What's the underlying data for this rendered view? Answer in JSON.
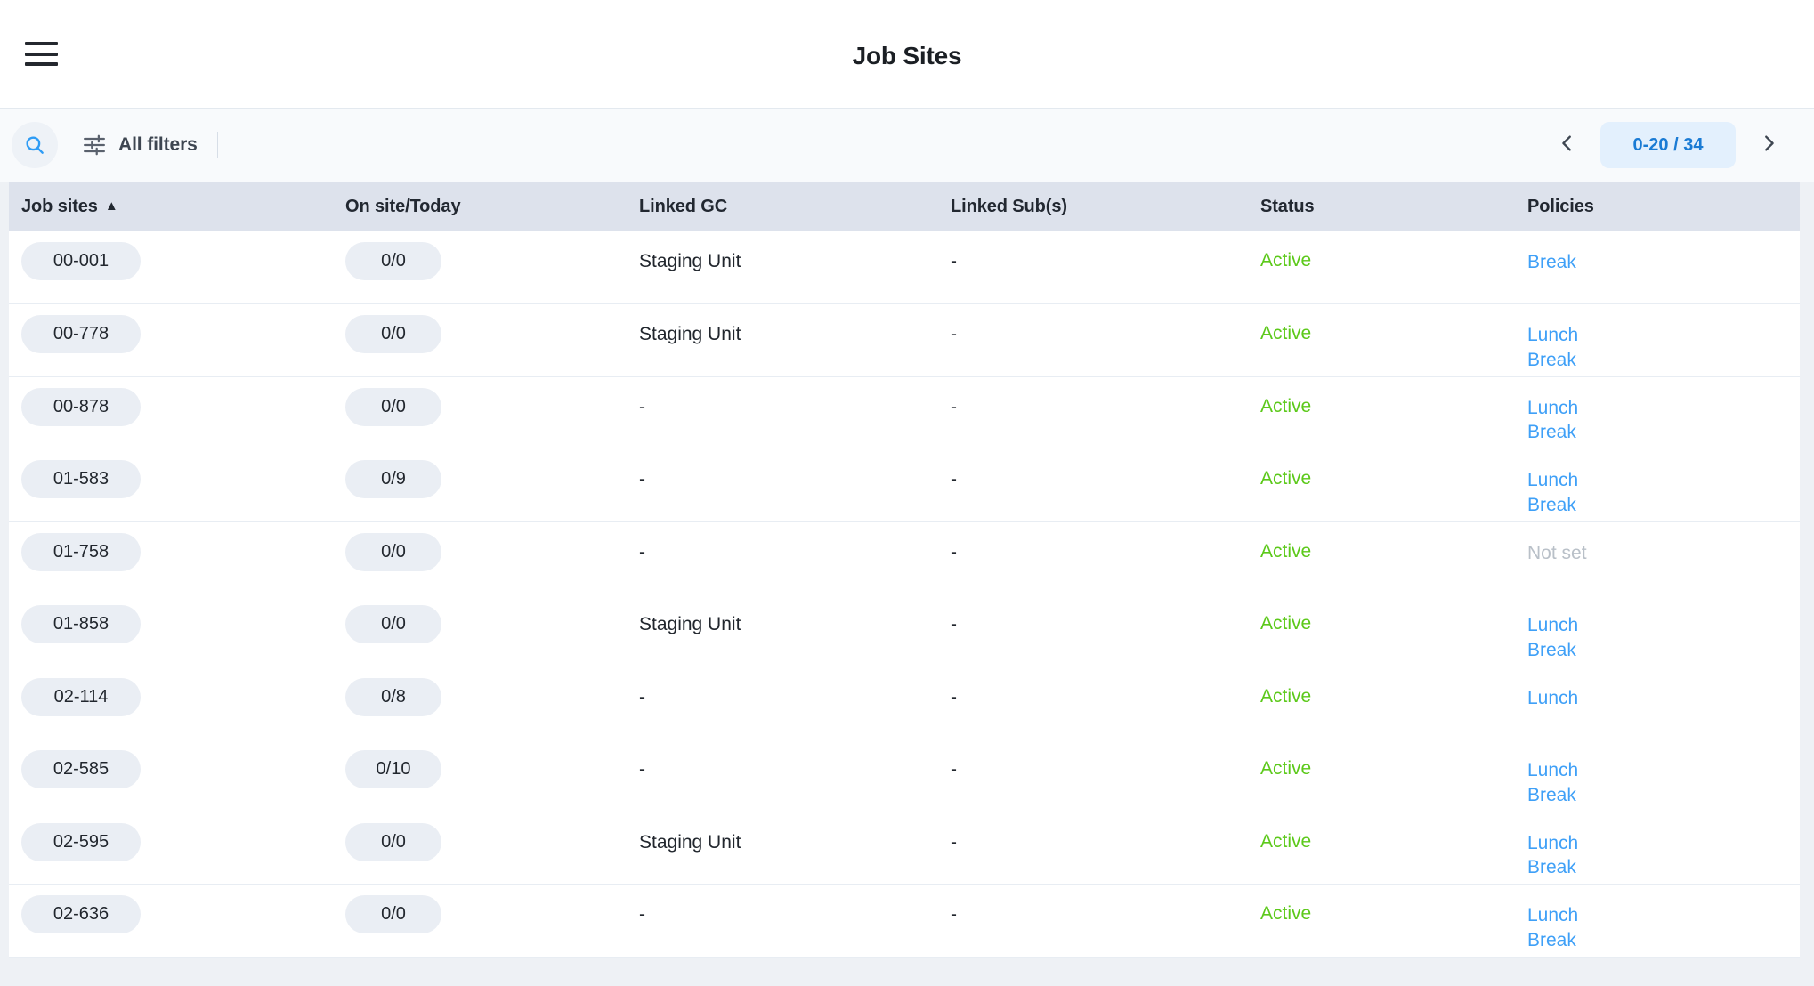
{
  "appbar": {
    "menu_icon": "hamburger-menu-icon",
    "title": "Job Sites"
  },
  "toolbar": {
    "search_icon": "search-icon",
    "filter_icon": "tune-sliders-icon",
    "filters_label": "All filters",
    "pagination": {
      "prev_icon": "chevron-left-icon",
      "next_icon": "chevron-right-icon",
      "range_label": "0-20 / 34"
    }
  },
  "table": {
    "columns": [
      {
        "key": "site",
        "label": "Job sites",
        "sorted": true,
        "sort_caret": "▲"
      },
      {
        "key": "count",
        "label": "On site/Today"
      },
      {
        "key": "gc",
        "label": "Linked GC"
      },
      {
        "key": "sub",
        "label": "Linked Sub(s)"
      },
      {
        "key": "status",
        "label": "Status"
      },
      {
        "key": "pol",
        "label": "Policies"
      }
    ],
    "rows": [
      {
        "site": "00-001",
        "count": "0/0",
        "gc": "Staging Unit",
        "sub": "-",
        "status": "Active",
        "policies": [
          "Break"
        ]
      },
      {
        "site": "00-778",
        "count": "0/0",
        "gc": "Staging Unit",
        "sub": "-",
        "status": "Active",
        "policies": [
          "Lunch",
          "Break"
        ]
      },
      {
        "site": "00-878",
        "count": "0/0",
        "gc": "-",
        "sub": "-",
        "status": "Active",
        "policies": [
          "Lunch",
          "Break"
        ]
      },
      {
        "site": "01-583",
        "count": "0/9",
        "gc": "-",
        "sub": "-",
        "status": "Active",
        "policies": [
          "Lunch",
          "Break"
        ]
      },
      {
        "site": "01-758",
        "count": "0/0",
        "gc": "-",
        "sub": "-",
        "status": "Active",
        "policies": [
          "Not set"
        ],
        "policies_unset": true
      },
      {
        "site": "01-858",
        "count": "0/0",
        "gc": "Staging Unit",
        "sub": "-",
        "status": "Active",
        "policies": [
          "Lunch",
          "Break"
        ]
      },
      {
        "site": "02-114",
        "count": "0/8",
        "gc": "-",
        "sub": "-",
        "status": "Active",
        "policies": [
          "Lunch"
        ]
      },
      {
        "site": "02-585",
        "count": "0/10",
        "gc": "-",
        "sub": "-",
        "status": "Active",
        "policies": [
          "Lunch",
          "Break"
        ]
      },
      {
        "site": "02-595",
        "count": "0/0",
        "gc": "Staging Unit",
        "sub": "-",
        "status": "Active",
        "policies": [
          "Lunch",
          "Break"
        ]
      },
      {
        "site": "02-636",
        "count": "0/0",
        "gc": "-",
        "sub": "-",
        "status": "Active",
        "policies": [
          "Lunch",
          "Break"
        ]
      }
    ]
  },
  "colors": {
    "status_active": "#5cc91a",
    "link_blue": "#3fa0f7",
    "accent_blue": "#1a7bd4",
    "pill_bg": "#eaeef4",
    "header_bg": "#dde2ec",
    "muted": "#b9c0c8"
  }
}
